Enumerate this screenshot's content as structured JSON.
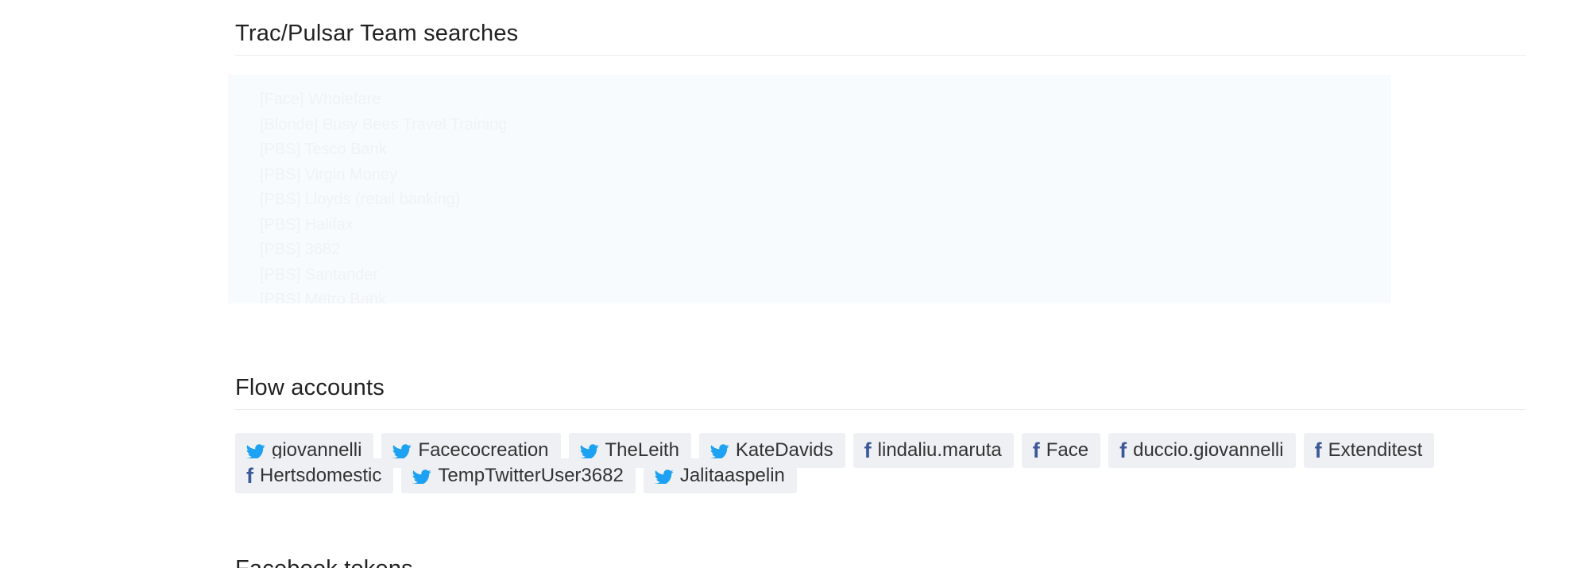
{
  "sections": {
    "searches_title": "Trac/Pulsar Team searches",
    "flow_title": "Flow accounts",
    "facebook_title": "Facebook tokens"
  },
  "searches": [
    "[Face] Wholefare",
    "[Blonde] Busy Bees Travel Training",
    "[PBS] Tesco Bank",
    "[PBS] Virgin Money",
    "[PBS] Lloyds (retail banking)",
    "[PBS] Halifax",
    "[PBS] 3682",
    "[PBS] Santander",
    "[PBS] Metro Bank"
  ],
  "accounts": [
    {
      "network": "twitter",
      "icon": "twitter-icon",
      "name": "giovannelli"
    },
    {
      "network": "twitter",
      "icon": "twitter-icon",
      "name": "Facecocreation"
    },
    {
      "network": "twitter",
      "icon": "twitter-icon",
      "name": "TheLeith"
    },
    {
      "network": "twitter",
      "icon": "twitter-icon",
      "name": "KateDavids"
    },
    {
      "network": "facebook",
      "icon": "facebook-icon",
      "name": "lindaliu.maruta"
    },
    {
      "network": "facebook",
      "icon": "facebook-icon",
      "name": "Face"
    },
    {
      "network": "facebook",
      "icon": "facebook-icon",
      "name": "duccio.giovannelli"
    },
    {
      "network": "facebook",
      "icon": "facebook-icon",
      "name": "Extenditest"
    },
    {
      "network": "facebook",
      "icon": "facebook-icon",
      "name": "Hertsdomestic"
    },
    {
      "network": "twitter",
      "icon": "twitter-icon",
      "name": "TempTwitterUser3682"
    },
    {
      "network": "twitter",
      "icon": "twitter-icon",
      "name": "Jalitaaspelin"
    }
  ],
  "colors": {
    "twitter": "#1da1f2",
    "facebook": "#3b5998",
    "chip_bg": "#eef0f3",
    "search_box_bg": "#f7fbfd"
  }
}
